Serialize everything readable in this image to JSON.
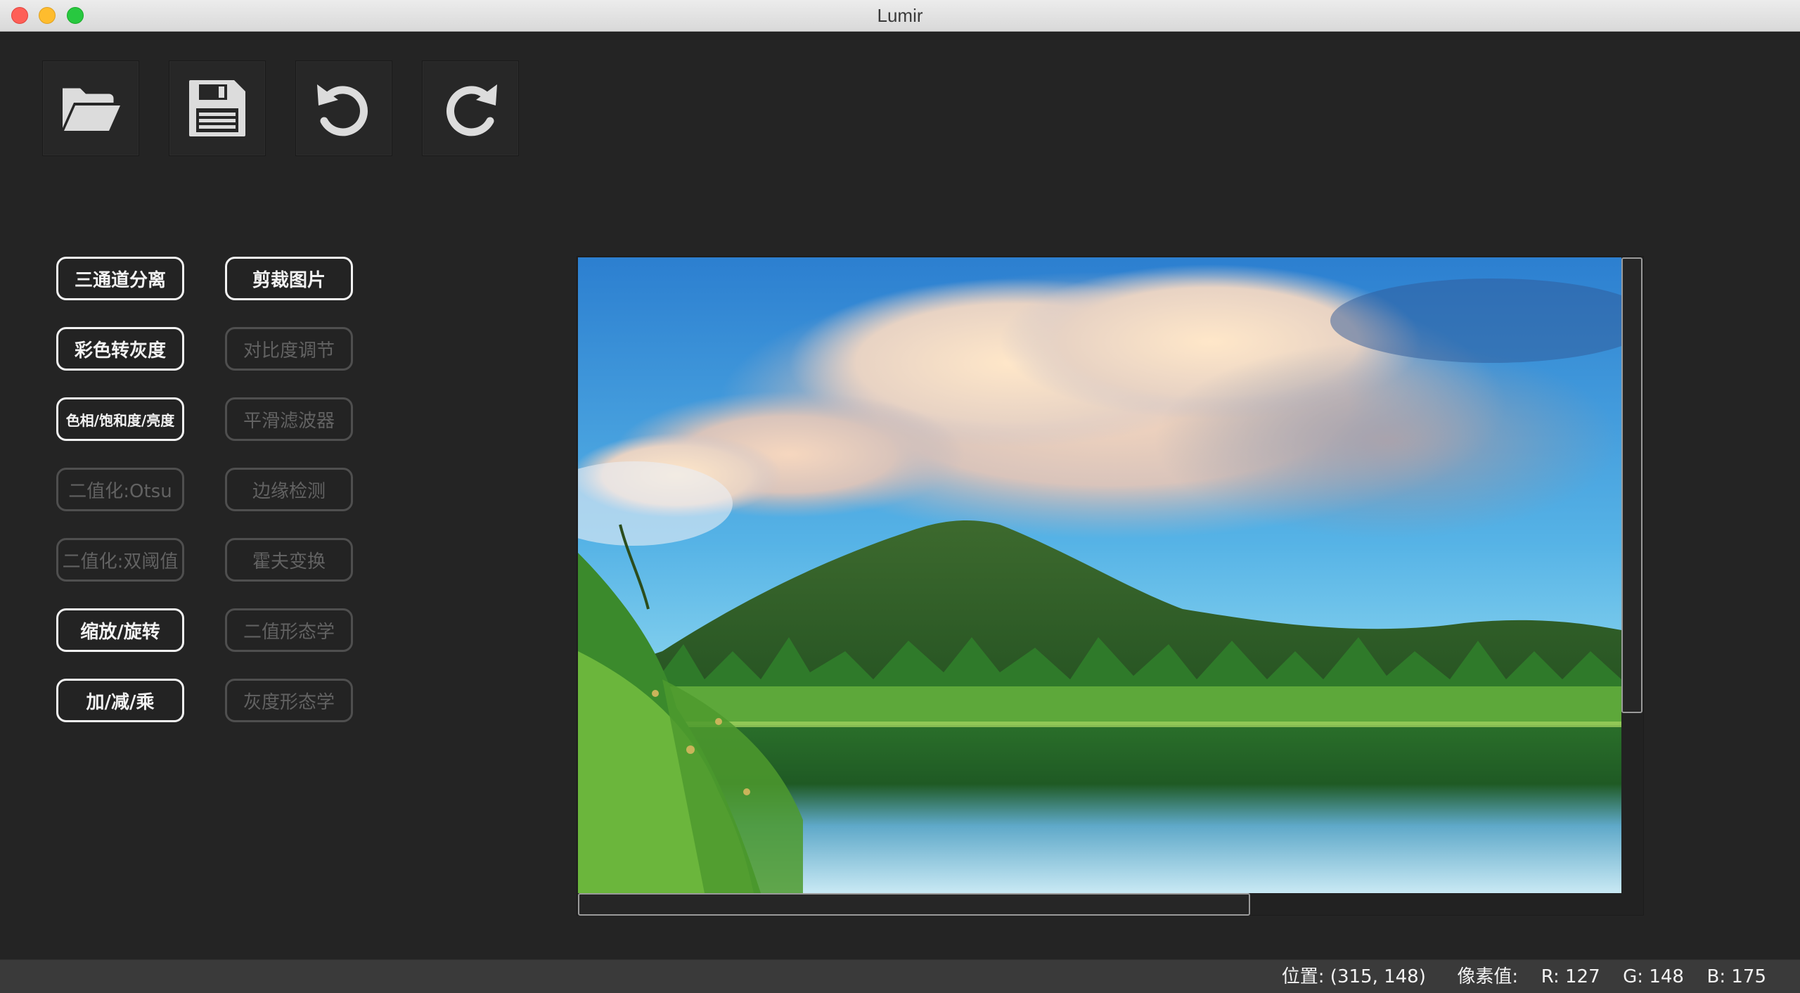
{
  "window": {
    "title": "Lumir"
  },
  "toolbar": {
    "items": [
      {
        "name": "open",
        "icon": "folder-open-icon"
      },
      {
        "name": "save",
        "icon": "floppy-disk-icon"
      },
      {
        "name": "undo",
        "icon": "undo-icon"
      },
      {
        "name": "redo",
        "icon": "redo-icon"
      }
    ]
  },
  "actions": {
    "left": [
      {
        "label": "三通道分离",
        "enabled": true
      },
      {
        "label": "彩色转灰度",
        "enabled": true
      },
      {
        "label": "色相/饱和度/亮度",
        "enabled": true
      },
      {
        "label": "二值化:Otsu",
        "enabled": false
      },
      {
        "label": "二值化:双阈值",
        "enabled": false
      },
      {
        "label": "缩放/旋转",
        "enabled": true
      },
      {
        "label": "加/减/乘",
        "enabled": true
      }
    ],
    "right": [
      {
        "label": "剪裁图片",
        "enabled": true
      },
      {
        "label": "对比度调节",
        "enabled": false
      },
      {
        "label": "平滑滤波器",
        "enabled": false
      },
      {
        "label": "边缘检测",
        "enabled": false
      },
      {
        "label": "霍夫变换",
        "enabled": false
      },
      {
        "label": "二值形态学",
        "enabled": false
      },
      {
        "label": "灰度形态学",
        "enabled": false
      }
    ]
  },
  "image": {
    "description_icon": "landscape-photo",
    "vertical_scroll_fraction_visible": 0.71,
    "horizontal_scroll_fraction_visible": 0.64
  },
  "status": {
    "position_label": "位置:",
    "position_value": "(315, 148)",
    "pixel_label": "像素值:",
    "r": "R: 127",
    "g": "G: 148",
    "b": "B: 175"
  },
  "colors": {
    "background": "#242424",
    "enabled_button": "#f2f2f2",
    "disabled_button": "#626262"
  }
}
